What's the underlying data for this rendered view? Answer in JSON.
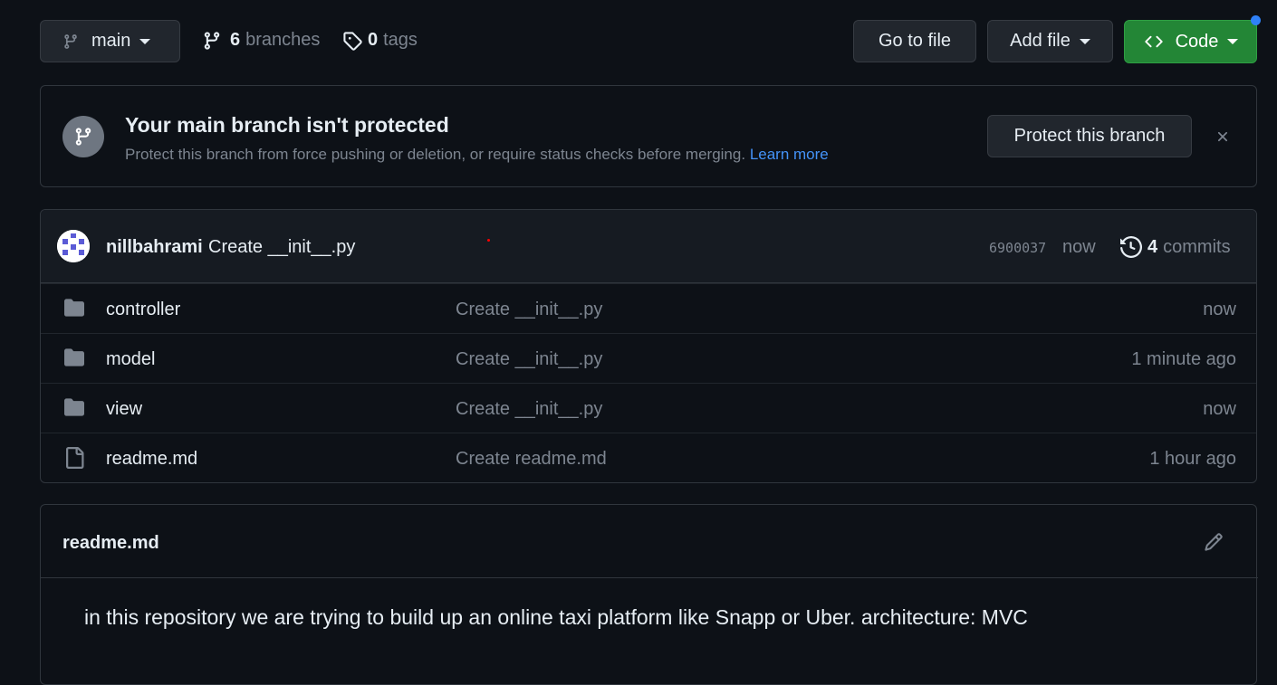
{
  "toolbar": {
    "branch_name": "main",
    "branches_count": "6",
    "branches_label": "branches",
    "tags_count": "0",
    "tags_label": "tags",
    "go_to_file_label": "Go to file",
    "add_file_label": "Add file",
    "code_label": "Code"
  },
  "protect_banner": {
    "title": "Your main branch isn't protected",
    "description": "Protect this branch from force pushing or deletion, or require status checks before merging.",
    "learn_more": "Learn more",
    "button_label": "Protect this branch"
  },
  "latest_commit": {
    "author": "nillbahrami",
    "message": "Create __init__.py",
    "sha": "6900037",
    "time": "now",
    "commits_count": "4",
    "commits_label": "commits"
  },
  "files": [
    {
      "name": "controller",
      "type": "folder",
      "message": "Create __init__.py",
      "age": "now"
    },
    {
      "name": "model",
      "type": "folder",
      "message": "Create __init__.py",
      "age": "1 minute ago"
    },
    {
      "name": "view",
      "type": "folder",
      "message": "Create __init__.py",
      "age": "now"
    },
    {
      "name": "readme.md",
      "type": "file",
      "message": "Create readme.md",
      "age": "1 hour ago"
    }
  ],
  "readme": {
    "title": "readme.md",
    "content": "in this repository we are trying to build up an online taxi platform like Snapp or Uber. architecture: MVC"
  },
  "icons": {
    "branch": "git-branch-icon",
    "tag": "tag-icon",
    "code": "code-icon",
    "close": "close-icon",
    "history": "history-icon",
    "folder": "folder-icon",
    "file": "file-icon",
    "edit": "pencil-icon"
  },
  "colors": {
    "background": "#0d1117",
    "accent_green": "#238636",
    "link_blue": "#4493f8",
    "muted": "#7d8590"
  }
}
